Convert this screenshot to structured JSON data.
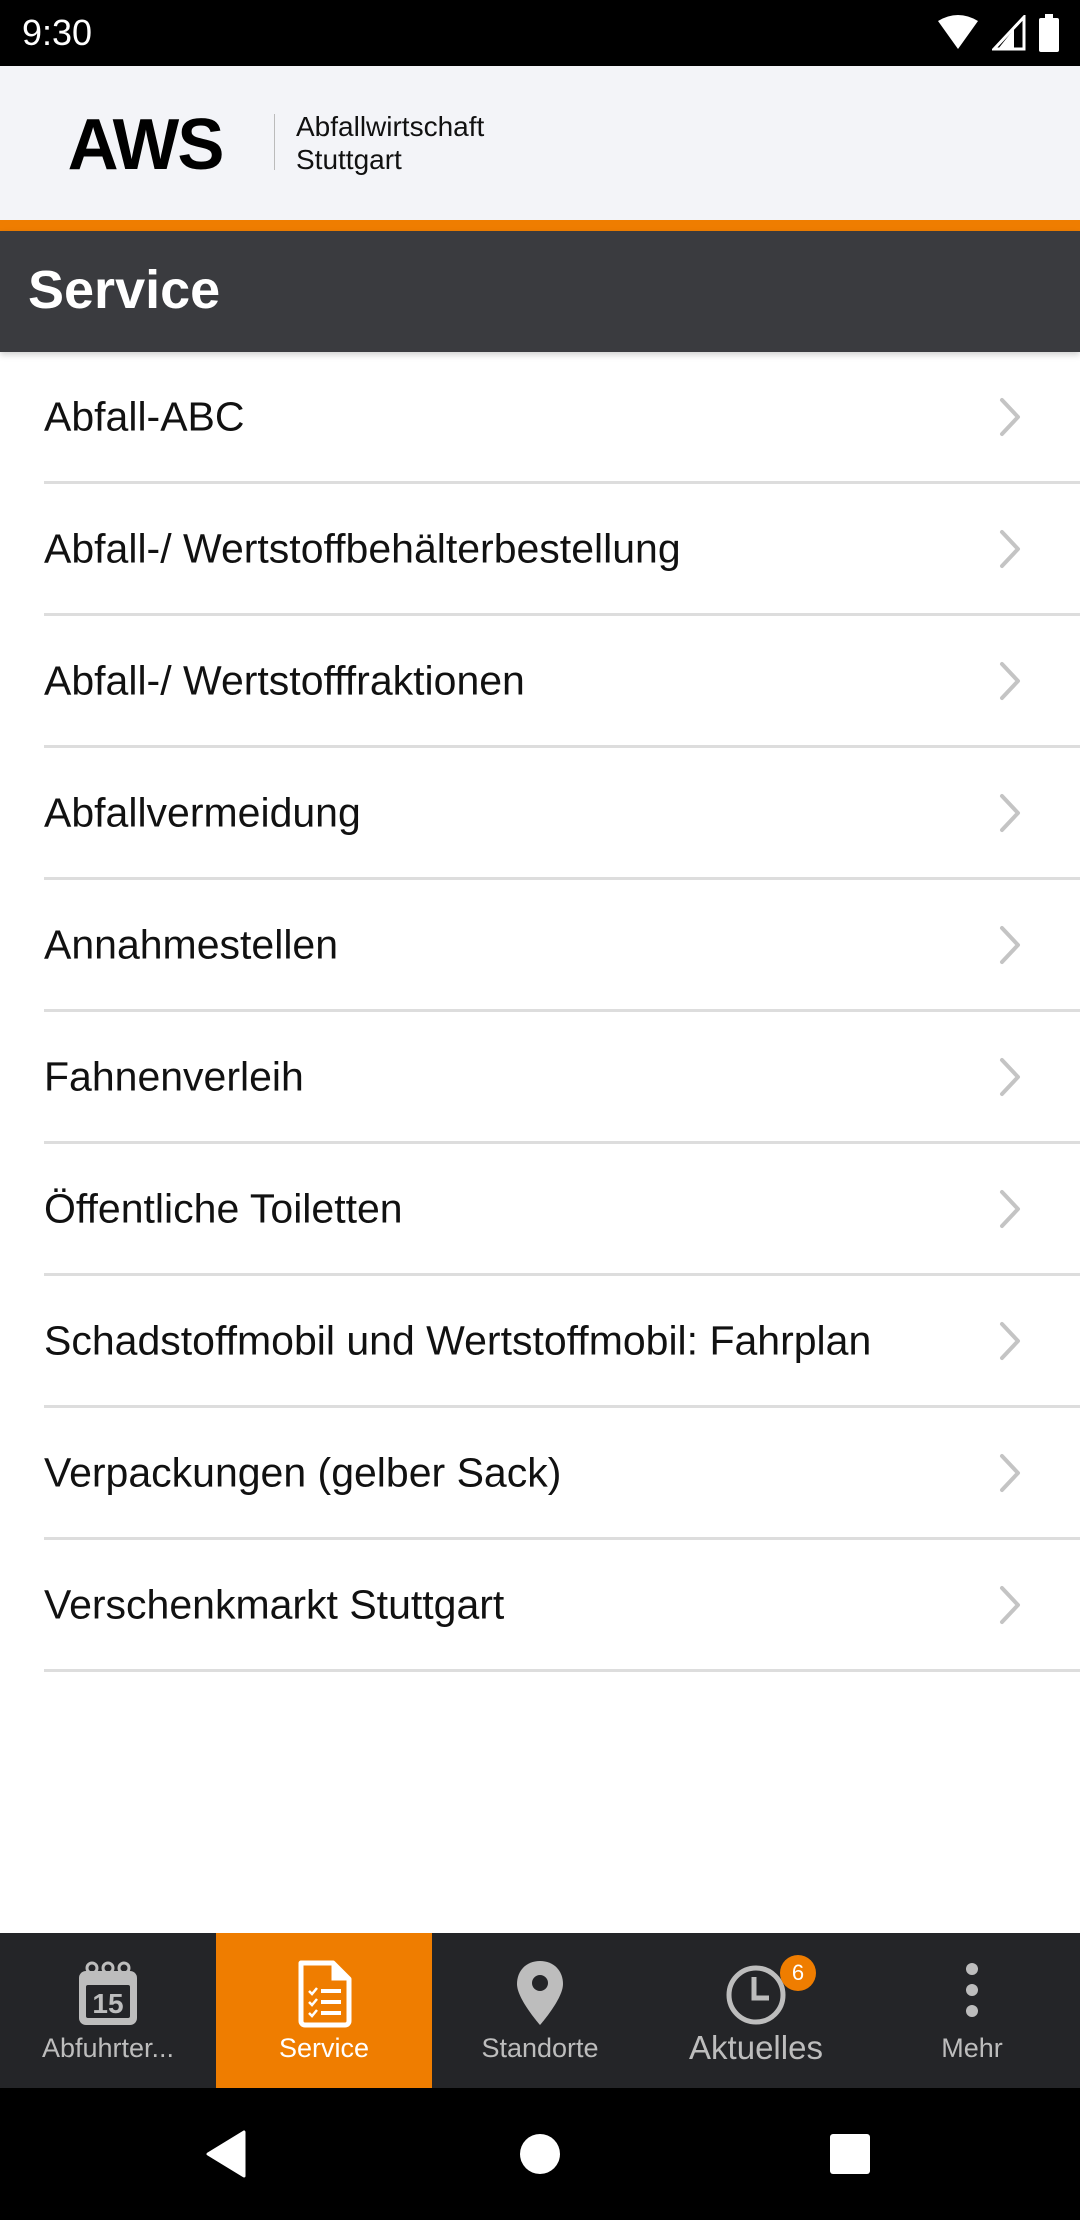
{
  "status_bar": {
    "time": "9:30",
    "icons": [
      "wifi-icon",
      "signal-icon",
      "battery-icon"
    ]
  },
  "brand": {
    "logo": "AWS",
    "subtitle_line1": "Abfallwirtschaft",
    "subtitle_line2": "Stuttgart"
  },
  "header": {
    "title": "Service"
  },
  "colors": {
    "accent": "#ef7d00",
    "titlebar": "#3a3b3f",
    "bottom_nav": "#242528",
    "brand_bg": "#f3f4f8"
  },
  "service_list": {
    "items": [
      {
        "label": "Abfall-ABC"
      },
      {
        "label": "Abfall-/ Wertstoffbehälterbestellung"
      },
      {
        "label": "Abfall-/ Wertstofffraktionen"
      },
      {
        "label": "Abfallvermeidung"
      },
      {
        "label": "Annahmestellen"
      },
      {
        "label": "Fahnenverleih"
      },
      {
        "label": "Öffentliche Toiletten"
      },
      {
        "label": "Schadstoffmobil und Wertstoffmobil: Fahrplan"
      },
      {
        "label": "Verpackungen (gelber Sack)"
      },
      {
        "label": "Verschenkmarkt Stuttgart"
      }
    ]
  },
  "bottom_nav": {
    "items": [
      {
        "label": "Abfuhrter...",
        "icon": "calendar-icon",
        "calendar_day": "15",
        "active": false
      },
      {
        "label": "Service",
        "icon": "checklist-document-icon",
        "active": true
      },
      {
        "label": "Standorte",
        "icon": "location-pin-icon",
        "active": false
      },
      {
        "label": "Aktuelles",
        "icon": "clock-icon",
        "badge": "6",
        "active": false
      },
      {
        "label": "Mehr",
        "icon": "more-vertical-icon",
        "active": false
      }
    ]
  },
  "system_nav": {
    "buttons": [
      "back-icon",
      "home-icon",
      "recents-icon"
    ]
  }
}
